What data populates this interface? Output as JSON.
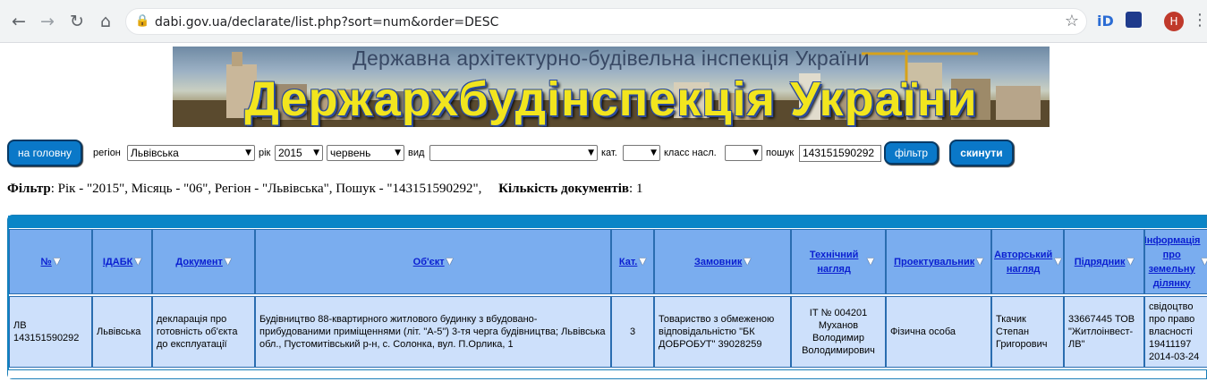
{
  "browser": {
    "url": "dabi.gov.ua/declarate/list.php?sort=num&order=DESC",
    "avatar_letter": "H"
  },
  "banner": {
    "subtitle": "Державна архітектурно-будівельна інспекція України",
    "title": "Держархбудінспекція України"
  },
  "filters": {
    "home_button": "на головну",
    "region_label": "регіон",
    "region_value": "Львівська",
    "year_label": "рік",
    "year_value": "2015",
    "month_value": "червень",
    "type_label": "вид",
    "type_value": "",
    "category_label": "кат.",
    "category_value": "",
    "class_label": "класс насл.",
    "class_value": "",
    "search_label": "пошук",
    "search_value": "143151590292",
    "filter_button": "фільтр",
    "reset_button": "скинути"
  },
  "summary": {
    "filter_label": "Фільтр",
    "filter_text": ": Рік - \"2015\", Місяць - \"06\", Регіон - \"Львівська\", Пошук - \"143151590292\",",
    "count_label": "Кількість документів",
    "count_value": ": 1"
  },
  "table": {
    "headers": [
      "№",
      "ІДАБК",
      "Документ",
      "Об'єкт",
      "Кат.",
      "Замовник",
      "Технічний нагляд",
      "Проектувальник",
      "Авторський нагляд",
      "Підрядник",
      "Інформація про земельну ділянку"
    ],
    "row": [
      "ЛВ 143151590292",
      "Львівська",
      "декларація про готовність об'єкта до експлуатації",
      "Будівництво 88-квартирного житлового будинку з вбудовано-прибудованими приміщеннями (літ. \"А-5\") 3-тя черга будівництва; Львівська обл., Пустомитівський р-н, с. Солонка, вул. П.Орлика, 1",
      "3",
      "Товариство з обмеженою відповідальністю \"БК ДОБРОБУТ\" 39028259",
      "ІТ № 004201 Муханов Володимир Володимирович",
      "Фізична особа",
      "Ткачик Степан Григорович",
      "33667445 ТОВ \"Житлоінвест-ЛВ\"",
      "свідоцтво про право власності 19411197 2014-03-24"
    ]
  },
  "icons": {
    "back": "arrow-left-icon",
    "forward": "arrow-right-icon",
    "reload": "reload-icon",
    "home": "home-icon",
    "lock": "lock-icon",
    "bookmark": "star-icon",
    "sort": "sort-down-icon"
  },
  "colors": {
    "header_bg": "#7aadef",
    "row_bg": "#cde0fb",
    "button_bg": "#0a78c8",
    "banner_title": "#f2e51e"
  }
}
